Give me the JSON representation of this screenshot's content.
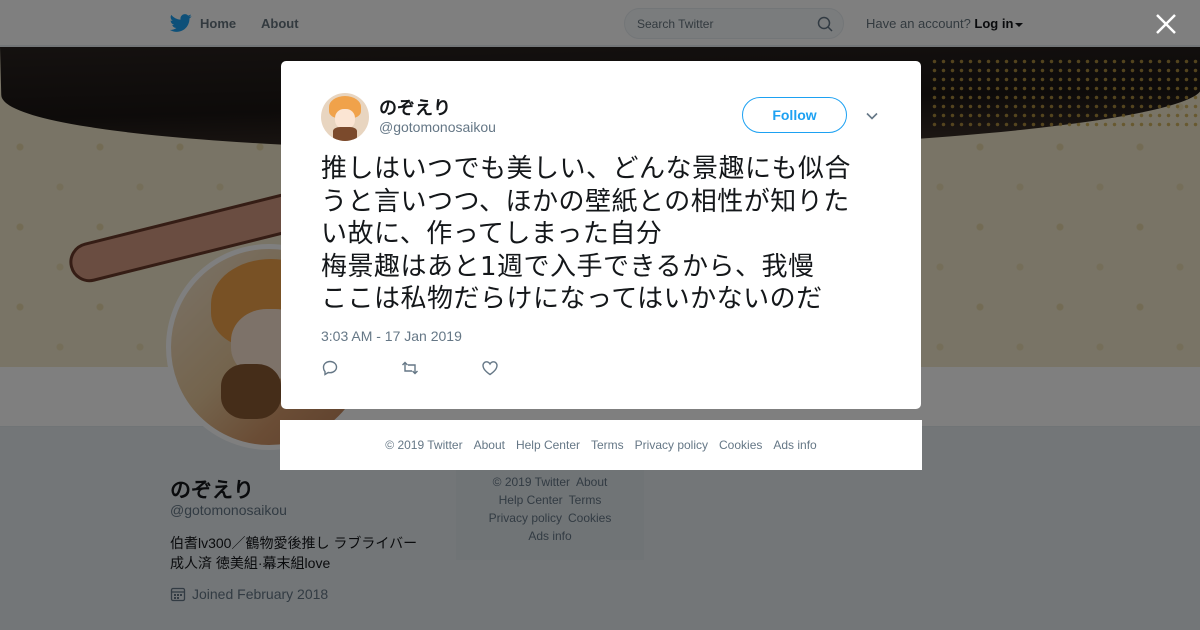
{
  "nav": {
    "home_label": "Home",
    "about_label": "About",
    "search_placeholder": "Search Twitter",
    "account_prompt": "Have an account?",
    "login_label": "Log in"
  },
  "profile": {
    "name": "のぞえり",
    "handle": "@gotomonosaikou",
    "bio_line1": "伯耆lv300／鶴物愛後推し ラブライバー",
    "bio_line2": "成人済 徳美組·幕末組love",
    "joined": "Joined February 2018"
  },
  "side_footer": {
    "copyright": "© 2019 Twitter",
    "about": "About",
    "help_center": "Help Center",
    "terms": "Terms",
    "privacy": "Privacy policy",
    "cookies": "Cookies",
    "ads_info": "Ads info"
  },
  "tweet": {
    "author_name": "のぞえり",
    "author_handle": "@gotomonosaikou",
    "follow_label": "Follow",
    "text": "推しはいつでも美しい、どんな景趣にも似合\nうと言いつつ、ほかの壁紙との相性が知りた\nい故に、作ってしまった自分\n梅景趣はあと1週で入手できるから、我慢\nここは私物だらけになってはいかないのだ",
    "timestamp": "3:03 AM - 17 Jan 2019"
  },
  "footer": {
    "copyright": "© 2019 Twitter",
    "about": "About",
    "help_center": "Help Center",
    "terms": "Terms",
    "privacy": "Privacy policy",
    "cookies": "Cookies",
    "ads_info": "Ads info"
  },
  "colors": {
    "brand": "#1da1f2",
    "text": "#14171a",
    "muted": "#657786",
    "overlay": "rgba(0,0,0,0.5)"
  },
  "icons": [
    "twitter-bird-icon",
    "search-icon",
    "caret-down-icon",
    "close-icon",
    "chevron-down-icon",
    "reply-icon",
    "retweet-icon",
    "like-icon",
    "calendar-icon"
  ]
}
